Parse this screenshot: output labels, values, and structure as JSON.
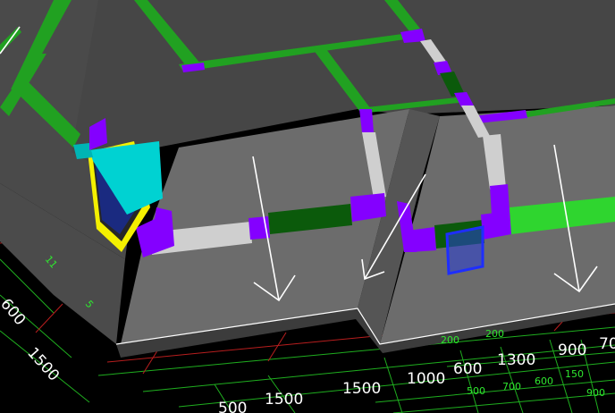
{
  "viewport": {
    "background": "#000000",
    "name": "3D building model viewport"
  },
  "colors": {
    "roof_top": "#464646",
    "wall_face": "#6c6c6c",
    "wall_dark": "#555555",
    "edge_white": "#ffffff",
    "green_beam": "#21a121",
    "green_bright": "#2fd52f",
    "green_dark": "#0b5a0b",
    "purple": "#8400ff",
    "light_gray": "#cfcfcf",
    "cyan": "#00d2d2",
    "yellow": "#f4f000",
    "blue": "#1e2eff",
    "grid_green": "#1fae1f",
    "grid_red": "#b81e1e"
  },
  "icons": {
    "arrow": "slope-arrow-icon",
    "window": "window-box-icon"
  },
  "dimensions": {
    "large": [
      "600",
      "1500",
      "500",
      "1500",
      "1500",
      "1000",
      "600",
      "1300",
      "900",
      "70"
    ],
    "small": [
      "200",
      "200",
      "500",
      "700",
      "600",
      "150",
      "900",
      "11",
      "5"
    ]
  }
}
